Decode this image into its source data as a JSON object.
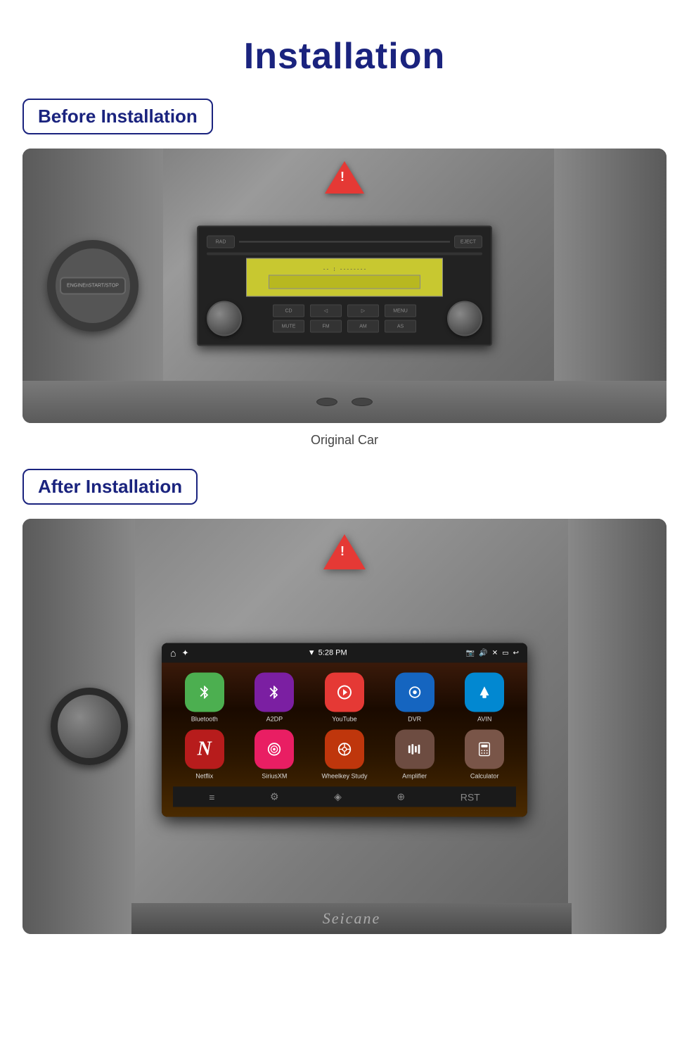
{
  "page": {
    "title": "Installation",
    "before_label": "Before Installation",
    "after_label": "After Installation",
    "original_car_label": "Original Car",
    "brand_label": "Seicane"
  },
  "colors": {
    "accent": "#1a237e",
    "badge_border": "#1a237e"
  },
  "apps_row1": [
    {
      "label": "Bluetooth",
      "icon_type": "bluetooth",
      "icon_char": "⚡",
      "bg_class": "app-bluetooth"
    },
    {
      "label": "A2DP",
      "icon_type": "bluetooth2",
      "icon_char": "✱",
      "bg_class": "app-a2dp"
    },
    {
      "label": "YouTube",
      "icon_type": "youtube",
      "icon_char": "▶",
      "bg_class": "app-youtube"
    },
    {
      "label": "DVR",
      "icon_type": "dvr",
      "icon_char": "◎",
      "bg_class": "app-dvr"
    },
    {
      "label": "AVIN",
      "icon_type": "avin",
      "icon_char": "↑",
      "bg_class": "app-avin"
    }
  ],
  "apps_row2": [
    {
      "label": "Netflix",
      "icon_type": "netflix",
      "icon_char": "N",
      "bg_class": "app-netflix"
    },
    {
      "label": "SiriusXM",
      "icon_type": "siriusxm",
      "icon_char": "⊕",
      "bg_class": "app-siriusxm"
    },
    {
      "label": "Wheelkey Study",
      "icon_type": "wheelkey",
      "icon_char": "⊙",
      "bg_class": "app-wheelkey"
    },
    {
      "label": "Amplifier",
      "icon_type": "amplifier",
      "icon_char": "▊▊",
      "bg_class": "app-amplifier"
    },
    {
      "label": "Calculator",
      "icon_type": "calculator",
      "icon_char": "⊞",
      "bg_class": "app-calculator"
    }
  ],
  "status_bar": {
    "time": "5:28 PM",
    "wifi_icon": "▼",
    "icons_right": [
      "📷",
      "🔊",
      "✖",
      "▭",
      "↩"
    ]
  }
}
